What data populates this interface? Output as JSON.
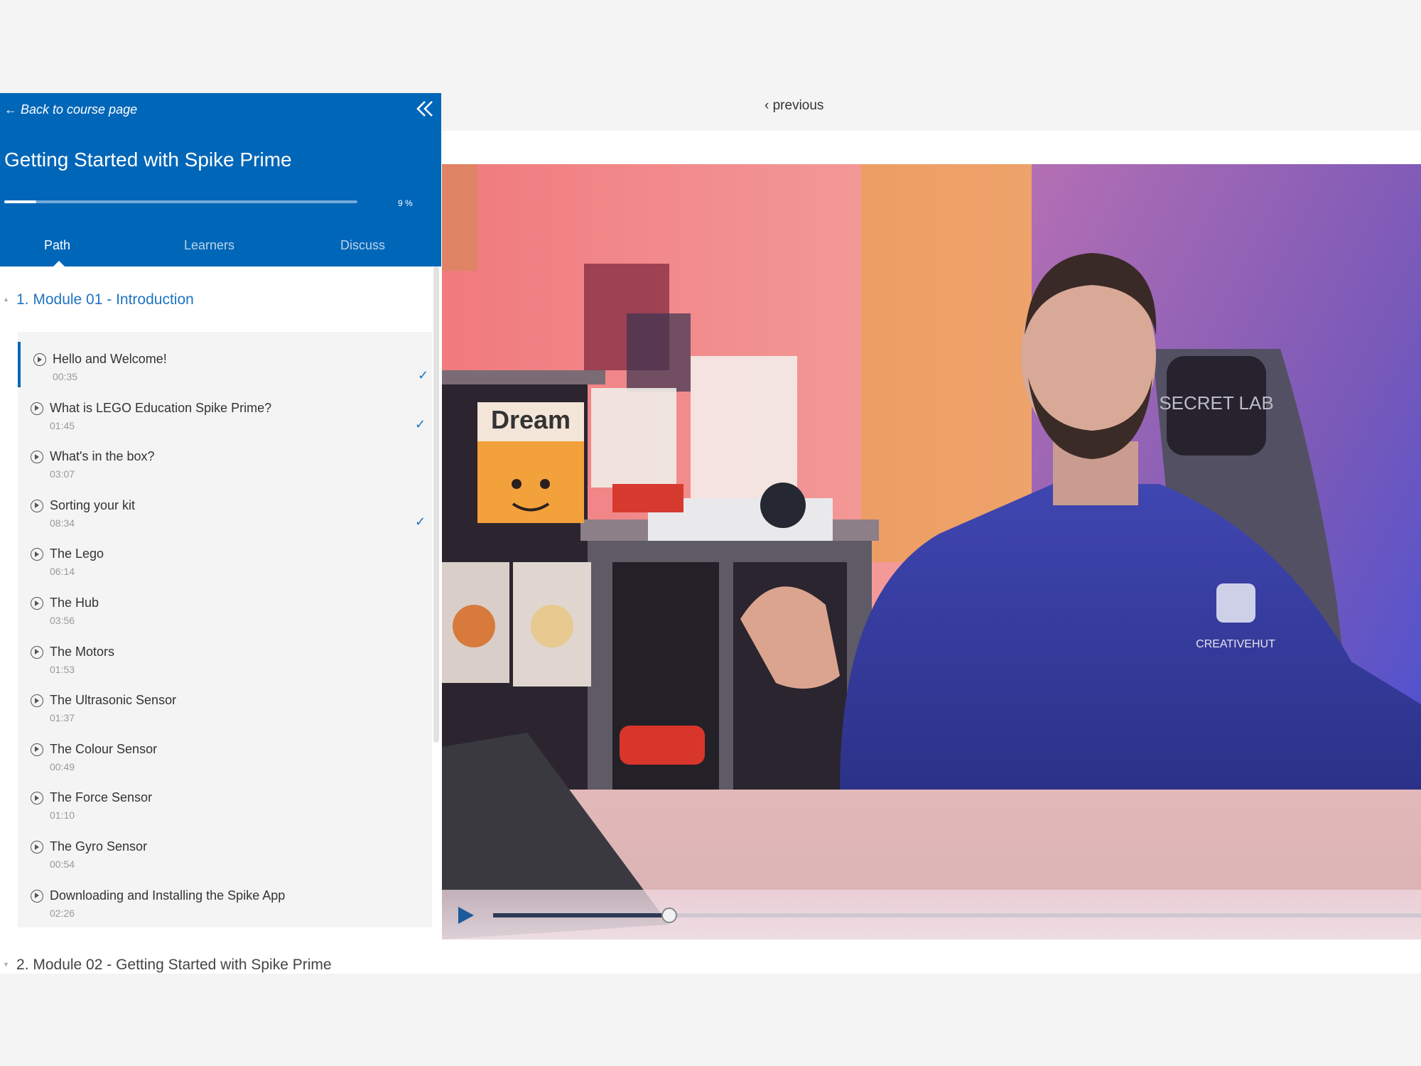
{
  "sidebar": {
    "back_label": "← Back to course page",
    "course_title": "Getting Started with Spike Prime",
    "progress": {
      "percent": 9,
      "label": "9 %"
    },
    "tabs": [
      {
        "label": "Path",
        "active": true
      },
      {
        "label": "Learners",
        "active": false
      },
      {
        "label": "Discuss",
        "active": false
      }
    ],
    "modules": [
      {
        "title": "1. Module 01 - Introduction",
        "expanded": true,
        "lessons": [
          {
            "title": "Hello and Welcome!",
            "duration": "00:35",
            "completed": true,
            "current": true
          },
          {
            "title": "What is LEGO Education Spike Prime?",
            "duration": "01:45",
            "completed": true,
            "current": false
          },
          {
            "title": "What's in the box?",
            "duration": "03:07",
            "completed": false,
            "current": false
          },
          {
            "title": "Sorting your kit",
            "duration": "08:34",
            "completed": true,
            "current": false
          },
          {
            "title": "The Lego",
            "duration": "06:14",
            "completed": false,
            "current": false
          },
          {
            "title": "The Hub",
            "duration": "03:56",
            "completed": false,
            "current": false
          },
          {
            "title": "The Motors",
            "duration": "01:53",
            "completed": false,
            "current": false
          },
          {
            "title": "The Ultrasonic Sensor",
            "duration": "01:37",
            "completed": false,
            "current": false
          },
          {
            "title": "The Colour Sensor",
            "duration": "00:49",
            "completed": false,
            "current": false
          },
          {
            "title": "The Force Sensor",
            "duration": "01:10",
            "completed": false,
            "current": false
          },
          {
            "title": "The Gyro Sensor",
            "duration": "00:54",
            "completed": false,
            "current": false
          },
          {
            "title": "Downloading and Installing the Spike App",
            "duration": "02:26",
            "completed": false,
            "current": false
          }
        ]
      },
      {
        "title": "2. Module 02 - Getting Started with Spike Prime",
        "expanded": false,
        "lessons": []
      }
    ]
  },
  "nav": {
    "previous_label": "‹ previous"
  },
  "video": {
    "played_fraction": 0.19,
    "scene_text": {
      "poster": "Dream",
      "chair": "SECRET LAB",
      "hoodie": "CREATIVEHUT"
    }
  },
  "colors": {
    "brand_blue": "#0066b8",
    "link_blue": "#1f74c0",
    "panel_gray": "#f4f4f4"
  },
  "icons": {
    "collapse": "double-chevron-left-icon",
    "lesson": "play-circle-icon",
    "done": "checkmark-icon",
    "player": "play-icon"
  }
}
